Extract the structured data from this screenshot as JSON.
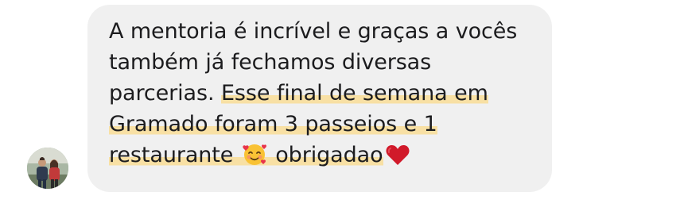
{
  "message": {
    "lines": [
      "A mentoria é incrível e graças a vocês",
      "também já fechamos diversas",
      "parcerias."
    ],
    "highlighted_line_3": "Esse final de semana em",
    "highlighted_line_4": "Gramado foram 3 passeios e 1",
    "highlighted_line_5a": "restaurante",
    "highlighted_line_5b": "obrigadao"
  },
  "icons": {
    "emoji_1": "smiling-face-with-hearts-icon",
    "emoji_2": "red-heart-icon"
  },
  "colors": {
    "bubble": "#f0f0f0",
    "text": "#1c1c1e",
    "highlight": "#f8dfa0",
    "heart": "#d11a2a"
  }
}
